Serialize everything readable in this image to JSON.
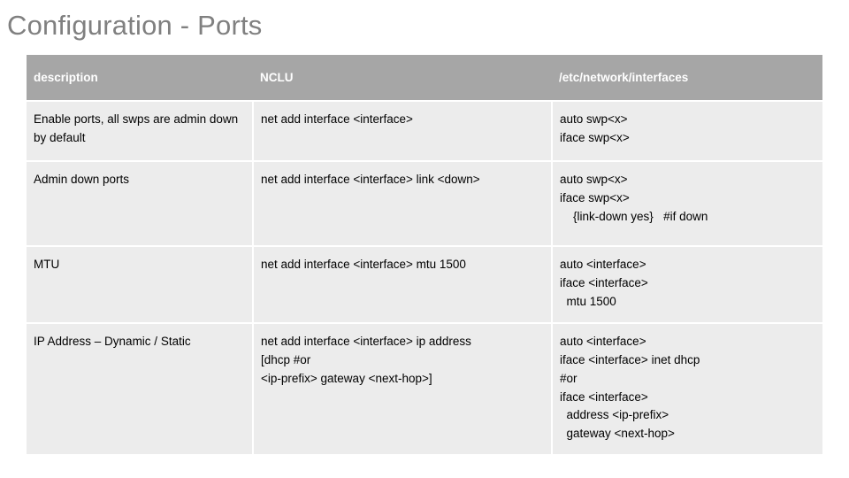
{
  "slide": {
    "title": "Configuration - Ports",
    "title_color": "#808080"
  },
  "table": {
    "headers": [
      "description",
      "NCLU",
      "/etc/network/interfaces"
    ],
    "header_bg": "#a6a6a6",
    "cell_bg": "#ececec",
    "rows": [
      {
        "description": "Enable ports, all swps are admin down by default",
        "nclu": "net add interface <interface>",
        "interfaces": "auto swp<x>\niface swp<x>"
      },
      {
        "description": "Admin down ports",
        "nclu": "net add interface <interface> link <down>",
        "interfaces": "auto swp<x>\niface swp<x>\n    {link-down yes}   #if down"
      },
      {
        "description": "MTU",
        "nclu": "net add interface <interface> mtu 1500",
        "interfaces": "auto <interface>\niface <interface>\n  mtu 1500"
      },
      {
        "description": "IP Address – Dynamic / Static",
        "nclu": "net add interface <interface> ip address\n[dhcp #or\n<ip-prefix> gateway <next-hop>]",
        "interfaces": "auto <interface>\niface <interface> inet dhcp\n#or\niface <interface>\n  address <ip-prefix>\n  gateway <next-hop>"
      }
    ]
  }
}
